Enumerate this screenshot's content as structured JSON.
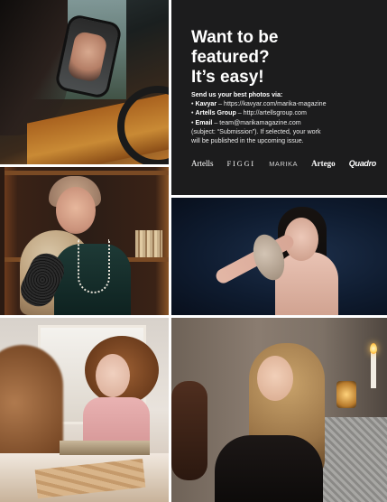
{
  "panel": {
    "headline": [
      "Want to be",
      "featured?",
      "It’s easy!"
    ],
    "intro": "Send us your best photos via:",
    "contacts": [
      {
        "name": "Kavyar",
        "detail": " – https://kavyar.com/marika-magazine"
      },
      {
        "name": "Artells Group",
        "detail": " – http://artellsgroup.com"
      },
      {
        "name": "Email",
        "detail": " – team@marikamagazine.com"
      }
    ],
    "subject_line": "(subject: “Submission”). If selected, your work",
    "publish_line": "will be published in the upcoming issue.",
    "logos": [
      "Artells",
      "FIGGI",
      "MARIKA",
      "Artego",
      "Quadro"
    ]
  },
  "colors": {
    "panel_bg": "#1c1c1d",
    "panel_text": "#ffffff"
  },
  "photos": [
    "woman-in-car-mirror-photo",
    "elderly-woman-bookshelf-photo",
    "woman-with-hand-mirror-photo",
    "curly-haired-girl-mirror-photo",
    "blonde-woman-candles-photo"
  ]
}
